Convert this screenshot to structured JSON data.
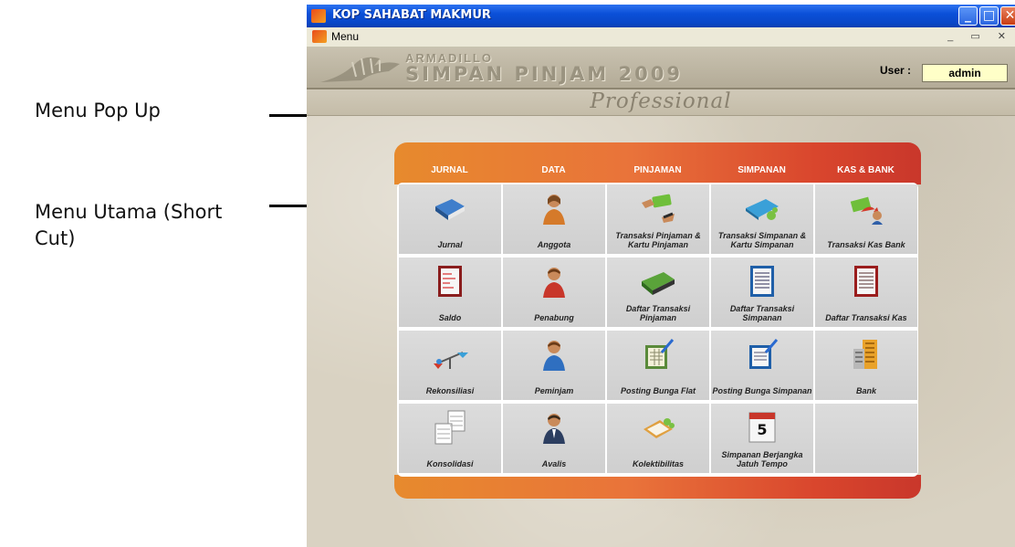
{
  "annotations": [
    {
      "text": "Menu Pop Up"
    },
    {
      "text": "Menu Utama (Short Cut)"
    }
  ],
  "window": {
    "title": "KOP SAHABAT MAKMUR",
    "controls": [
      "minimize",
      "maximize",
      "close"
    ]
  },
  "menubar": {
    "item": "Menu"
  },
  "banner": {
    "brand_line1": "ARMADILLO",
    "brand_line2": "SIMPAN PINJAM 2009",
    "subtitle": "Professional",
    "user_label": "User :",
    "user_value": "admin"
  },
  "panel": {
    "columns": [
      "JURNAL",
      "DATA",
      "PINJAMAN",
      "SIMPANAN",
      "KAS & BANK"
    ],
    "items": [
      {
        "label": "Jurnal",
        "icon": "book-icon"
      },
      {
        "label": "Anggota",
        "icon": "person-icon"
      },
      {
        "label": "Transaksi Pinjaman & Kartu Pinjaman",
        "icon": "money-handover-icon"
      },
      {
        "label": "Transaksi Simpanan & Kartu Simpanan",
        "icon": "savings-card-icon"
      },
      {
        "label": "Transaksi Kas Bank",
        "icon": "cash-transfer-icon"
      },
      {
        "label": "Saldo",
        "icon": "ledger-icon"
      },
      {
        "label": "Penabung",
        "icon": "person-icon"
      },
      {
        "label": "Daftar Transaksi Pinjaman",
        "icon": "loan-book-icon"
      },
      {
        "label": "Daftar Transaksi Simpanan",
        "icon": "list-document-icon"
      },
      {
        "label": "Daftar Transaksi Kas",
        "icon": "list-document-red-icon"
      },
      {
        "label": "Rekonsiliasi",
        "icon": "balance-scale-icon"
      },
      {
        "label": "Peminjam",
        "icon": "person-icon"
      },
      {
        "label": "Posting Bunga Flat",
        "icon": "posting-pen-icon"
      },
      {
        "label": "Posting Bunga Simpanan",
        "icon": "posting-pen-icon"
      },
      {
        "label": "Bank",
        "icon": "bank-building-icon"
      },
      {
        "label": "Konsolidasi",
        "icon": "spreadsheets-icon"
      },
      {
        "label": "Avalis",
        "icon": "businessman-icon"
      },
      {
        "label": "Kolektibilitas",
        "icon": "clipboard-icon"
      },
      {
        "label": "Simpanan Berjangka Jatuh Tempo",
        "icon": "calendar-icon",
        "calendar_day": "5"
      },
      {
        "label": "",
        "icon": ""
      }
    ]
  },
  "colors": {
    "panel_gradient_start": "#e78a2d",
    "panel_gradient_end": "#c9372b",
    "xp_titlebar": "#0b50d8"
  }
}
